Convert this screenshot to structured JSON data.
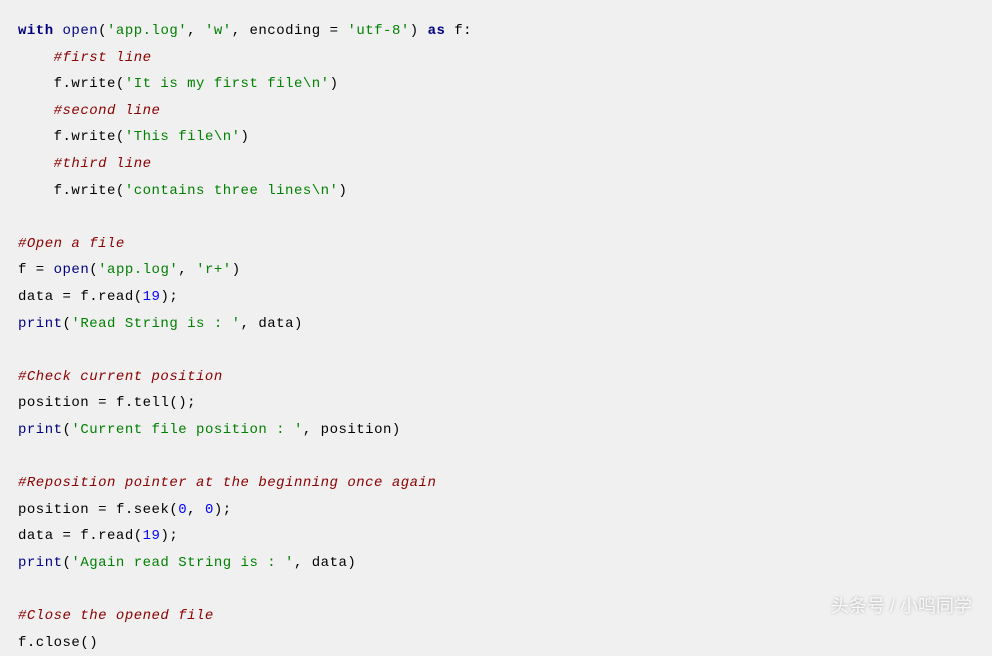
{
  "code": {
    "l1_with": "with",
    "l1_open": "open",
    "l1_s1": "'app.log'",
    "l1_s2": "'w'",
    "l1_enc": "encoding",
    "l1_s3": "'utf-8'",
    "l1_as": "as",
    "l1_f": "f:",
    "l2": "#first line",
    "l3_f": "f.write",
    "l3_s": "'It is my first file\\n'",
    "l4": "#second line",
    "l5_f": "f.write",
    "l5_s": "'This file\\n'",
    "l6": "#third line",
    "l7_f": "f.write",
    "l7_s": "'contains three lines\\n'",
    "l8": "#Open a file",
    "l9_f": "f",
    "l9_open": "open",
    "l9_s1": "'app.log'",
    "l9_s2": "'r+'",
    "l10_data": "data",
    "l10_f": "f.read",
    "l10_n": "19",
    "l11_print": "print",
    "l11_s": "'Read String is : '",
    "l11_data": "data",
    "l12": "#Check current position",
    "l13_pos": "position",
    "l13_f": "f.tell",
    "l14_print": "print",
    "l14_s": "'Current file position : '",
    "l14_pos": "position",
    "l15": "#Reposition pointer at the beginning once again",
    "l16_pos": "position",
    "l16_f": "f.seek",
    "l16_n1": "0",
    "l16_n2": "0",
    "l17_data": "data",
    "l17_f": "f.read",
    "l17_n": "19",
    "l18_print": "print",
    "l18_s": "'Again read String is : '",
    "l18_data": "data",
    "l19": "#Close the opened file",
    "l20_f": "f.close"
  },
  "watermark": "头条号 / 小鸣同学"
}
